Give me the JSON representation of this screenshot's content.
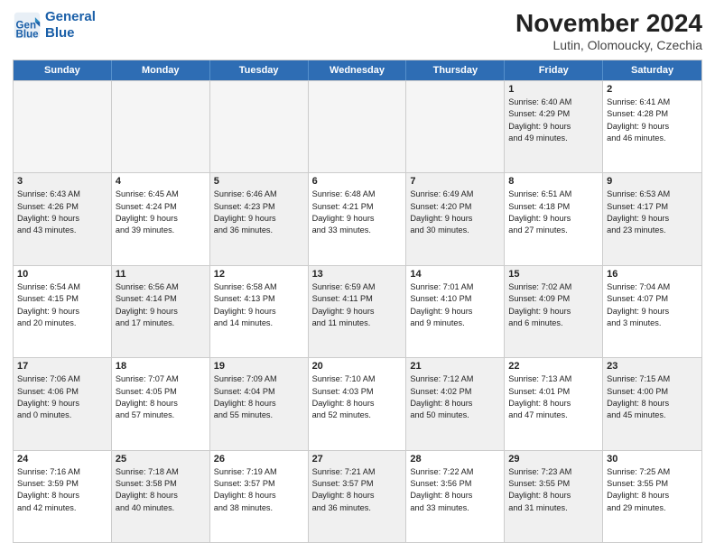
{
  "header": {
    "logo_line1": "General",
    "logo_line2": "Blue",
    "month_title": "November 2024",
    "subtitle": "Lutin, Olomoucky, Czechia"
  },
  "weekdays": [
    "Sunday",
    "Monday",
    "Tuesday",
    "Wednesday",
    "Thursday",
    "Friday",
    "Saturday"
  ],
  "rows": [
    [
      {
        "day": "",
        "empty": true
      },
      {
        "day": "",
        "empty": true
      },
      {
        "day": "",
        "empty": true
      },
      {
        "day": "",
        "empty": true
      },
      {
        "day": "",
        "empty": true
      },
      {
        "day": "1",
        "lines": [
          "Sunrise: 6:40 AM",
          "Sunset: 4:29 PM",
          "Daylight: 9 hours",
          "and 49 minutes."
        ],
        "shaded": true
      },
      {
        "day": "2",
        "lines": [
          "Sunrise: 6:41 AM",
          "Sunset: 4:28 PM",
          "Daylight: 9 hours",
          "and 46 minutes."
        ],
        "shaded": false
      }
    ],
    [
      {
        "day": "3",
        "lines": [
          "Sunrise: 6:43 AM",
          "Sunset: 4:26 PM",
          "Daylight: 9 hours",
          "and 43 minutes."
        ],
        "shaded": true
      },
      {
        "day": "4",
        "lines": [
          "Sunrise: 6:45 AM",
          "Sunset: 4:24 PM",
          "Daylight: 9 hours",
          "and 39 minutes."
        ],
        "shaded": false
      },
      {
        "day": "5",
        "lines": [
          "Sunrise: 6:46 AM",
          "Sunset: 4:23 PM",
          "Daylight: 9 hours",
          "and 36 minutes."
        ],
        "shaded": true
      },
      {
        "day": "6",
        "lines": [
          "Sunrise: 6:48 AM",
          "Sunset: 4:21 PM",
          "Daylight: 9 hours",
          "and 33 minutes."
        ],
        "shaded": false
      },
      {
        "day": "7",
        "lines": [
          "Sunrise: 6:49 AM",
          "Sunset: 4:20 PM",
          "Daylight: 9 hours",
          "and 30 minutes."
        ],
        "shaded": true
      },
      {
        "day": "8",
        "lines": [
          "Sunrise: 6:51 AM",
          "Sunset: 4:18 PM",
          "Daylight: 9 hours",
          "and 27 minutes."
        ],
        "shaded": false
      },
      {
        "day": "9",
        "lines": [
          "Sunrise: 6:53 AM",
          "Sunset: 4:17 PM",
          "Daylight: 9 hours",
          "and 23 minutes."
        ],
        "shaded": true
      }
    ],
    [
      {
        "day": "10",
        "lines": [
          "Sunrise: 6:54 AM",
          "Sunset: 4:15 PM",
          "Daylight: 9 hours",
          "and 20 minutes."
        ],
        "shaded": false
      },
      {
        "day": "11",
        "lines": [
          "Sunrise: 6:56 AM",
          "Sunset: 4:14 PM",
          "Daylight: 9 hours",
          "and 17 minutes."
        ],
        "shaded": true
      },
      {
        "day": "12",
        "lines": [
          "Sunrise: 6:58 AM",
          "Sunset: 4:13 PM",
          "Daylight: 9 hours",
          "and 14 minutes."
        ],
        "shaded": false
      },
      {
        "day": "13",
        "lines": [
          "Sunrise: 6:59 AM",
          "Sunset: 4:11 PM",
          "Daylight: 9 hours",
          "and 11 minutes."
        ],
        "shaded": true
      },
      {
        "day": "14",
        "lines": [
          "Sunrise: 7:01 AM",
          "Sunset: 4:10 PM",
          "Daylight: 9 hours",
          "and 9 minutes."
        ],
        "shaded": false
      },
      {
        "day": "15",
        "lines": [
          "Sunrise: 7:02 AM",
          "Sunset: 4:09 PM",
          "Daylight: 9 hours",
          "and 6 minutes."
        ],
        "shaded": true
      },
      {
        "day": "16",
        "lines": [
          "Sunrise: 7:04 AM",
          "Sunset: 4:07 PM",
          "Daylight: 9 hours",
          "and 3 minutes."
        ],
        "shaded": false
      }
    ],
    [
      {
        "day": "17",
        "lines": [
          "Sunrise: 7:06 AM",
          "Sunset: 4:06 PM",
          "Daylight: 9 hours",
          "and 0 minutes."
        ],
        "shaded": true
      },
      {
        "day": "18",
        "lines": [
          "Sunrise: 7:07 AM",
          "Sunset: 4:05 PM",
          "Daylight: 8 hours",
          "and 57 minutes."
        ],
        "shaded": false
      },
      {
        "day": "19",
        "lines": [
          "Sunrise: 7:09 AM",
          "Sunset: 4:04 PM",
          "Daylight: 8 hours",
          "and 55 minutes."
        ],
        "shaded": true
      },
      {
        "day": "20",
        "lines": [
          "Sunrise: 7:10 AM",
          "Sunset: 4:03 PM",
          "Daylight: 8 hours",
          "and 52 minutes."
        ],
        "shaded": false
      },
      {
        "day": "21",
        "lines": [
          "Sunrise: 7:12 AM",
          "Sunset: 4:02 PM",
          "Daylight: 8 hours",
          "and 50 minutes."
        ],
        "shaded": true
      },
      {
        "day": "22",
        "lines": [
          "Sunrise: 7:13 AM",
          "Sunset: 4:01 PM",
          "Daylight: 8 hours",
          "and 47 minutes."
        ],
        "shaded": false
      },
      {
        "day": "23",
        "lines": [
          "Sunrise: 7:15 AM",
          "Sunset: 4:00 PM",
          "Daylight: 8 hours",
          "and 45 minutes."
        ],
        "shaded": true
      }
    ],
    [
      {
        "day": "24",
        "lines": [
          "Sunrise: 7:16 AM",
          "Sunset: 3:59 PM",
          "Daylight: 8 hours",
          "and 42 minutes."
        ],
        "shaded": false
      },
      {
        "day": "25",
        "lines": [
          "Sunrise: 7:18 AM",
          "Sunset: 3:58 PM",
          "Daylight: 8 hours",
          "and 40 minutes."
        ],
        "shaded": true
      },
      {
        "day": "26",
        "lines": [
          "Sunrise: 7:19 AM",
          "Sunset: 3:57 PM",
          "Daylight: 8 hours",
          "and 38 minutes."
        ],
        "shaded": false
      },
      {
        "day": "27",
        "lines": [
          "Sunrise: 7:21 AM",
          "Sunset: 3:57 PM",
          "Daylight: 8 hours",
          "and 36 minutes."
        ],
        "shaded": true
      },
      {
        "day": "28",
        "lines": [
          "Sunrise: 7:22 AM",
          "Sunset: 3:56 PM",
          "Daylight: 8 hours",
          "and 33 minutes."
        ],
        "shaded": false
      },
      {
        "day": "29",
        "lines": [
          "Sunrise: 7:23 AM",
          "Sunset: 3:55 PM",
          "Daylight: 8 hours",
          "and 31 minutes."
        ],
        "shaded": true
      },
      {
        "day": "30",
        "lines": [
          "Sunrise: 7:25 AM",
          "Sunset: 3:55 PM",
          "Daylight: 8 hours",
          "and 29 minutes."
        ],
        "shaded": false
      }
    ]
  ]
}
